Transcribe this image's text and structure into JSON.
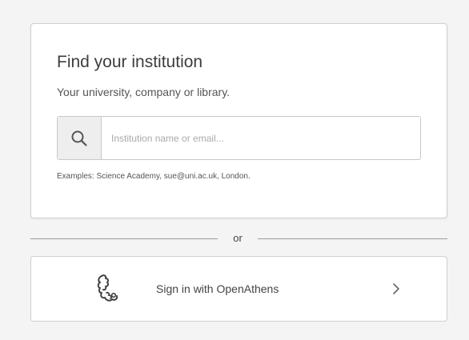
{
  "institution_search": {
    "title": "Find your institution",
    "subtitle": "Your university, company or library.",
    "input_placeholder": "Institution name or email...",
    "input_value": "",
    "examples": "Examples: Science Academy, sue@uni.ac.uk, London."
  },
  "divider": {
    "label": "or"
  },
  "openathens": {
    "label": "Sign in with OpenAthens"
  },
  "icons": {
    "search": "search-icon",
    "openathens_logo": "openathens-logo-icon",
    "chevron": "chevron-right-icon"
  }
}
